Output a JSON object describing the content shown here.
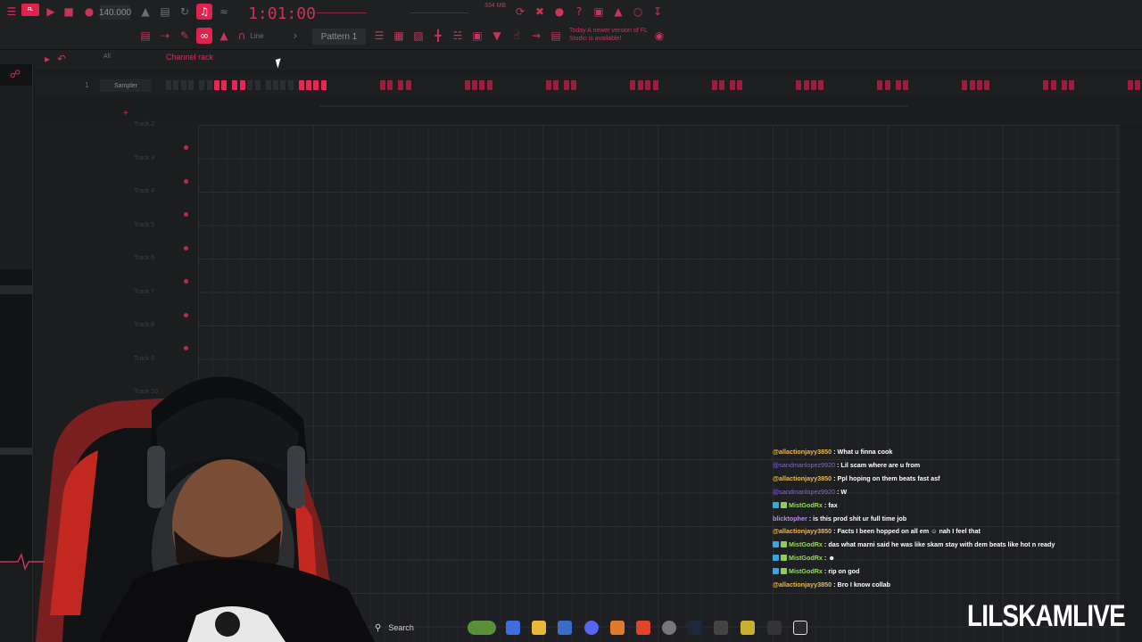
{
  "toolbar": {
    "tempo": "140.000",
    "timecode": "1:01:00",
    "memory": "334 MB",
    "pattern_label": "Pattern 1",
    "snap_mode": "Line",
    "news_text": "Today  A newer version of FL Studio is available!",
    "logo_text": "FL"
  },
  "channel_rack": {
    "title": "Channel rack",
    "filter": "All",
    "channels": [
      {
        "number": "1",
        "name": "Sampler",
        "steps": [
          0,
          0,
          0,
          0,
          0,
          0,
          1,
          1,
          1,
          1,
          0,
          0,
          0,
          0,
          0,
          0,
          1,
          1,
          1,
          1
        ]
      }
    ]
  },
  "playlist": {
    "tracks": [
      "Track 2",
      "Track 3",
      "Track 4",
      "Track 5",
      "Track 6",
      "Track 7",
      "Track 8",
      "Track 9",
      "Track 10"
    ]
  },
  "chat": {
    "messages": [
      {
        "user": "@allactionjayy3850",
        "text": " : What u finna cook",
        "style": "gold"
      },
      {
        "user": "@sandmanlopez9920",
        "text": " : Lil scam where are u from",
        "style": "purple"
      },
      {
        "user": "@allactionjayy3850",
        "text": " : Ppl hoping on them beats fast asf",
        "style": "gold"
      },
      {
        "user": "@sandmanlopez9920",
        "text": " : W",
        "style": "purple"
      },
      {
        "user": "MistGodRx",
        "text": " : fax",
        "style": "green",
        "badge": true
      },
      {
        "user": "blicktopher",
        "text": " : is this prod shit ur full time job",
        "style": "purple2"
      },
      {
        "user": "@allactionjayy3850",
        "text": " : Facts I been hopped on all em ☺ nah I feel that",
        "style": "gold"
      },
      {
        "user": "MistGodRx",
        "text": " : das what marni said he was like skam stay with dem beats like hot n ready",
        "style": "green",
        "badge": true
      },
      {
        "user": "MistGodRx",
        "text": " :  ☻",
        "style": "green",
        "badge": true
      },
      {
        "user": "MistGodRx",
        "text": " : rip on god",
        "style": "green",
        "badge": true
      },
      {
        "user": "@allactionjayy3850",
        "text": " : Bro I know collab",
        "style": "gold"
      }
    ]
  },
  "taskbar": {
    "search_label": "Search"
  },
  "overlay": {
    "brand": "LILSKAMLIVE"
  },
  "colors": {
    "accent": "#e0224e",
    "background": "#1c1d1f"
  }
}
